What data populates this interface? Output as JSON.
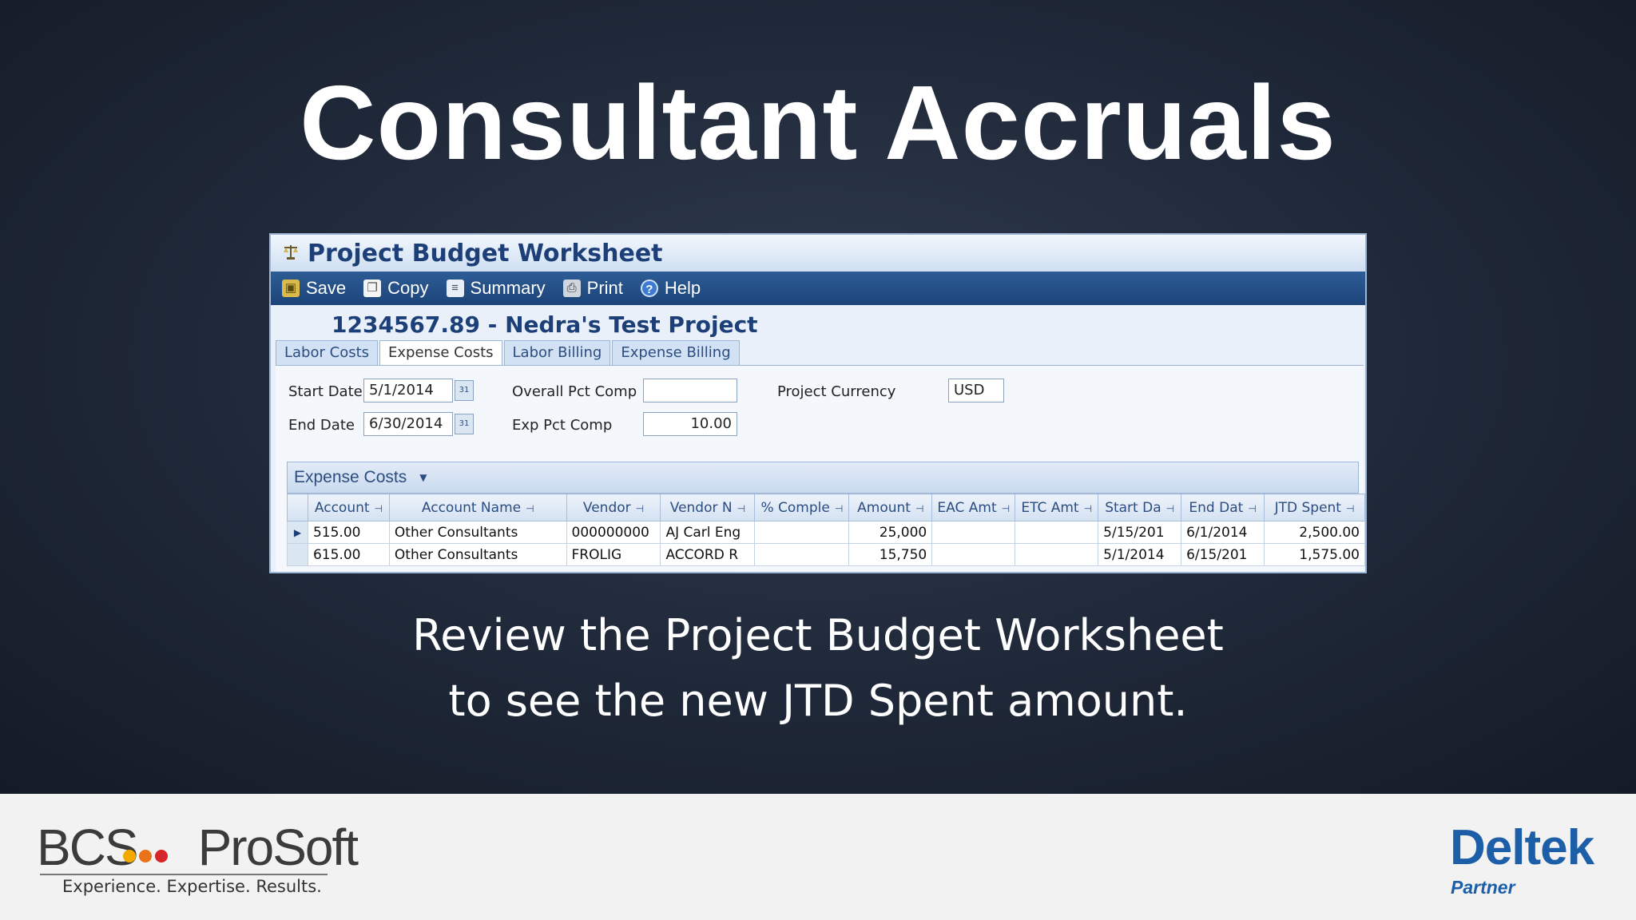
{
  "slide": {
    "title": "Consultant Accruals",
    "caption_line1": "Review the Project Budget Worksheet",
    "caption_line2": "to see the new JTD Spent amount."
  },
  "window": {
    "title": "Project Budget Worksheet",
    "title_icon": "scales-icon",
    "toolbar": [
      {
        "label": "Save",
        "icon": "save-icon"
      },
      {
        "label": "Copy",
        "icon": "copy-icon"
      },
      {
        "label": "Summary",
        "icon": "summary-icon"
      },
      {
        "label": "Print",
        "icon": "print-icon"
      },
      {
        "label": "Help",
        "icon": "help-icon"
      }
    ],
    "project_header": "1234567.89 - Nedra's Test Project",
    "tabs": [
      {
        "label": "Labor Costs",
        "active": false
      },
      {
        "label": "Expense Costs",
        "active": true
      },
      {
        "label": "Labor Billing",
        "active": false
      },
      {
        "label": "Expense Billing",
        "active": false
      }
    ],
    "form": {
      "start_date_label": "Start Date",
      "start_date_value": "5/1/2014",
      "end_date_label": "End Date",
      "end_date_value": "6/30/2014",
      "overall_pct_label": "Overall Pct Comp",
      "overall_pct_value": "",
      "exp_pct_label": "Exp Pct Comp",
      "exp_pct_value": "10.00",
      "currency_label": "Project Currency",
      "currency_value": "USD"
    },
    "grid": {
      "title": "Expense Costs",
      "columns": [
        "Account",
        "Account Name",
        "Vendor",
        "Vendor N",
        "% Comple",
        "Amount",
        "EAC Amt",
        "ETC Amt",
        "Start Da",
        "End Dat",
        "JTD Spent"
      ],
      "rows": [
        [
          "515.00",
          "Other Consultants",
          "000000000",
          "AJ Carl Eng",
          "",
          "25,000",
          "",
          "",
          "5/15/201",
          "6/1/2014",
          "2,500.00"
        ],
        [
          "615.00",
          "Other Consultants",
          "FROLIG",
          "ACCORD R",
          "",
          "15,750",
          "",
          "",
          "5/1/2014",
          "6/15/201",
          "1,575.00"
        ]
      ]
    }
  },
  "footer": {
    "bcs_left": "BCS",
    "bcs_right": "ProSoft",
    "bcs_tagline": "Experience. Expertise. Results.",
    "dot_colors": [
      "#f2a900",
      "#e8731a",
      "#d6262b"
    ],
    "deltek_name": "Deltek",
    "deltek_partner": "Partner"
  },
  "colors": {
    "toolbar_bg": "#1c4479",
    "title_text": "#1d3f78",
    "deltek_blue": "#1d5ea8"
  }
}
